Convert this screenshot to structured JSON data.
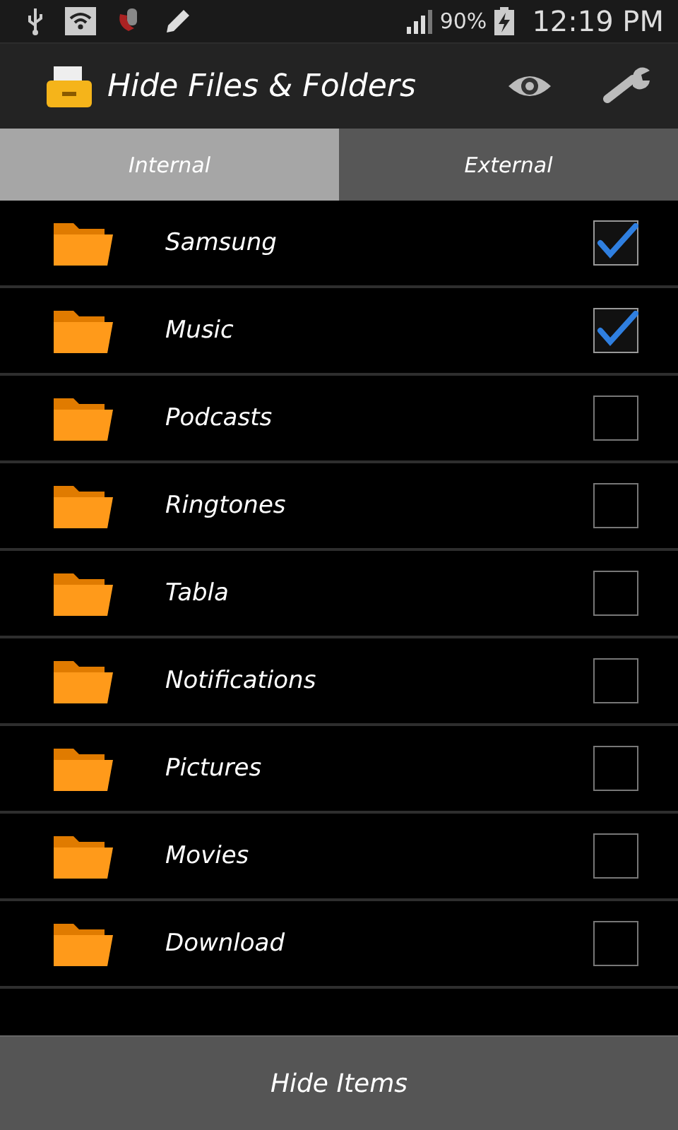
{
  "status_bar": {
    "battery": "90%",
    "time": "12:19 PM"
  },
  "app_bar": {
    "title": "Hide Files & Folders"
  },
  "tabs": [
    {
      "label": "Internal",
      "selected": true
    },
    {
      "label": "External",
      "selected": false
    }
  ],
  "folders": [
    {
      "name": "Samsung",
      "checked": true
    },
    {
      "name": "Music",
      "checked": true
    },
    {
      "name": "Podcasts",
      "checked": false
    },
    {
      "name": "Ringtones",
      "checked": false
    },
    {
      "name": "Tabla",
      "checked": false
    },
    {
      "name": "Notifications",
      "checked": false
    },
    {
      "name": "Pictures",
      "checked": false
    },
    {
      "name": "Movies",
      "checked": false
    },
    {
      "name": "Download",
      "checked": false
    }
  ],
  "action_button": {
    "label": "Hide Items"
  }
}
